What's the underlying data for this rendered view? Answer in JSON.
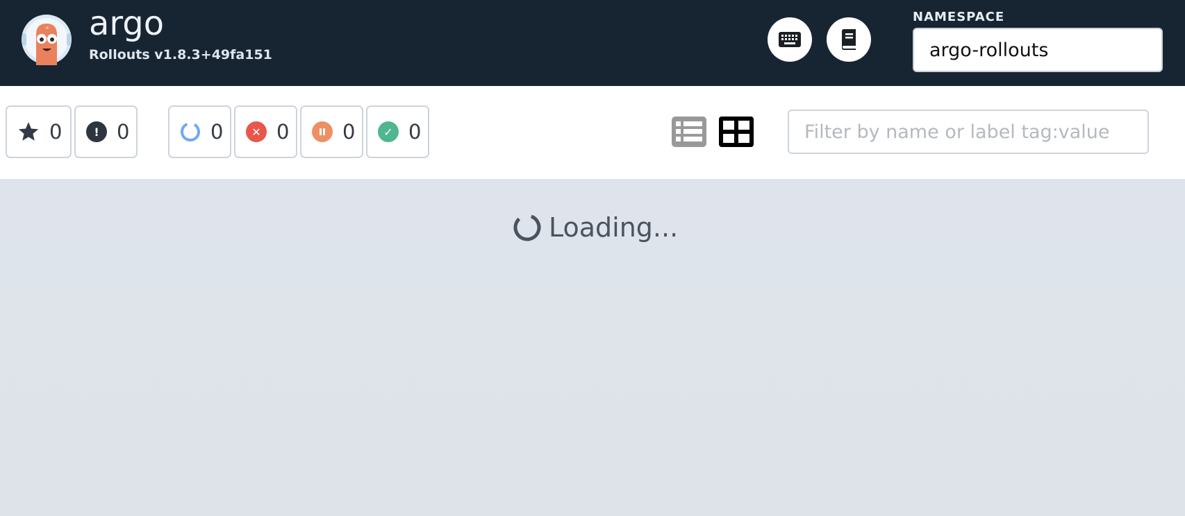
{
  "header": {
    "brand": "argo",
    "version": "Rollouts v1.8.3+49fa151",
    "namespace_label": "NAMESPACE",
    "namespace_value": "argo-rollouts",
    "keyboard_icon": "keyboard-icon",
    "docs_icon": "book-icon"
  },
  "toolbar": {
    "filters": [
      {
        "icon": "star-icon",
        "count": "0"
      },
      {
        "icon": "alert-icon",
        "count": "0"
      },
      {
        "icon": "progressing-icon",
        "count": "0",
        "color": "#6fa8f5"
      },
      {
        "icon": "degraded-icon",
        "count": "0",
        "color": "#e8574b"
      },
      {
        "icon": "paused-icon",
        "count": "0",
        "color": "#ee8f63"
      },
      {
        "icon": "healthy-icon",
        "count": "0",
        "color": "#4fb68f"
      }
    ],
    "search_placeholder": "Filter by name or label tag:value"
  },
  "main": {
    "loading_text": "Loading..."
  },
  "colors": {
    "header_bg": "#172533",
    "main_bg": "#dfe4ea"
  }
}
